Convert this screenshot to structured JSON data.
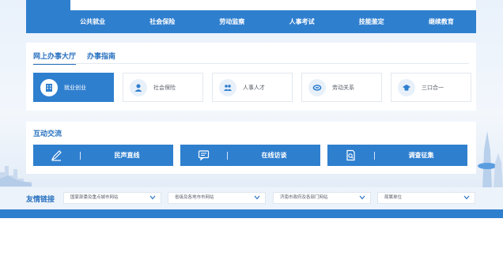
{
  "top_nav": {
    "items": [
      "公共就业",
      "社会保险",
      "劳动监察",
      "人事考试",
      "技能鉴定",
      "继续教育"
    ]
  },
  "hall": {
    "tabs": [
      {
        "label": "网上办事大厅",
        "active": true
      },
      {
        "label": "办事指南",
        "active": false
      }
    ],
    "cards": [
      {
        "label": "就业创业",
        "icon": "building-icon",
        "active": true
      },
      {
        "label": "社会保险",
        "icon": "person-icon",
        "active": false
      },
      {
        "label": "人事人才",
        "icon": "people-icon",
        "active": false
      },
      {
        "label": "劳动关系",
        "icon": "handshake-icon",
        "active": false
      },
      {
        "label": "三口合一",
        "icon": "graduation-cap-icon",
        "active": false
      }
    ]
  },
  "interaction": {
    "title": "互动交流",
    "buttons": [
      {
        "label": "民声直线",
        "icon": "pen-icon"
      },
      {
        "label": "在线访谈",
        "icon": "chat-icon"
      },
      {
        "label": "调查征集",
        "icon": "survey-icon"
      }
    ]
  },
  "friend_links": {
    "title": "友情链接",
    "selects": [
      "国家部委及重点城市网站",
      "省级及各地市市网站",
      "济南市政府及各部门网站",
      "局属单位"
    ]
  },
  "colors": {
    "primary": "#2f7fcf",
    "accent_text": "#2a72c0"
  }
}
